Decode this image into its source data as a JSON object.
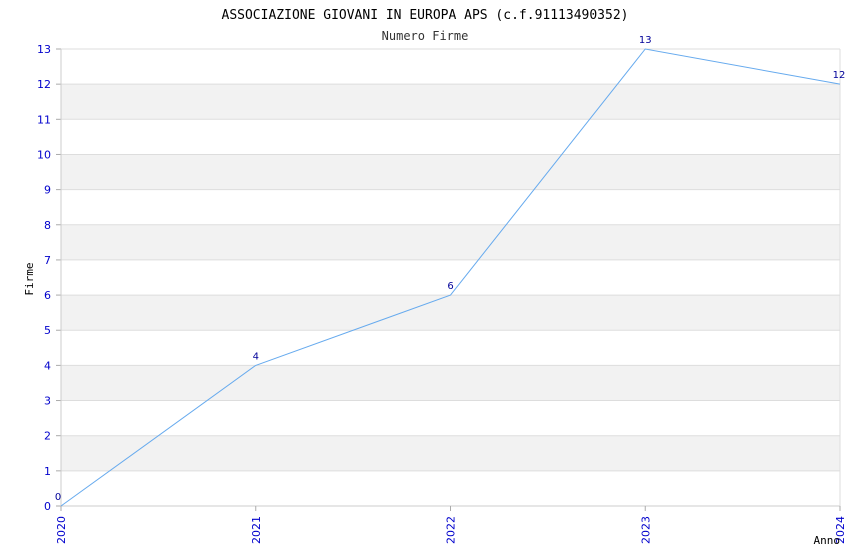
{
  "chart_data": {
    "type": "line",
    "title": "ASSOCIAZIONE GIOVANI IN EUROPA APS (c.f.91113490352)",
    "subtitle": "Numero Firme",
    "xlabel": "Anno",
    "ylabel": "Firme",
    "categories": [
      "2020",
      "2021",
      "2022",
      "2023",
      "2024"
    ],
    "series": [
      {
        "values": [
          0,
          4,
          6,
          13,
          12
        ]
      }
    ],
    "ylim": [
      0,
      13
    ],
    "yticks": [
      "0",
      "1",
      "2",
      "3",
      "4",
      "5",
      "6",
      "7",
      "8",
      "9",
      "10",
      "11",
      "12",
      "13"
    ],
    "grid": true,
    "colors": {
      "line": "#66aaee",
      "band": "#f2f2f2",
      "tick_text": "#0000cc",
      "data_label": "#000099"
    }
  }
}
